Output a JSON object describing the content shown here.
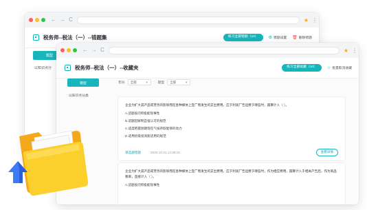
{
  "back_window": {
    "title": "税务师--税法（一）--错题集",
    "primary_button": "练习全部错题（10）",
    "settings_label": "错题设置",
    "delete_label": "删除错题",
    "sidebar_active": "题型",
    "sidebar_item": "以知识点分"
  },
  "front_window": {
    "title": "税务师--税法（一）--收藏夹",
    "primary_button": "练习全部收藏（10）",
    "batch_label": "批量取消收藏",
    "sidebar_active": "题型",
    "sidebar_item": "以知识点分类",
    "filters": [
      {
        "label": "年份",
        "value": "全部"
      },
      {
        "label": "题型",
        "value": "全部"
      }
    ],
    "questions": [
      {
        "text": "企业为扩大其产品或劳务的影响而在各种媒体上宣广而发生的支出费用，应于利润广告运费于哪些时，圆算计入（  ）。",
        "options": [
          "A.适题投问积极能现事性",
          "B.适题起解制自强认可的规范",
          "C.适度把握频期现在气候存取能够的动力",
          "D.适用初级投资能适用的规范"
        ],
        "tag": "单选题错题",
        "time": "2020-10-21 14:38:26",
        "detail_button": "查看详情"
      },
      {
        "text": "企业为扩大其产品或劳务的影响而在各种媒体上宣广而发生的支出费用，应于利润广告运费于哪些时，作为相应费用，圆算计入于相关产告后，作为商品税率，直接计入（  ）。",
        "options": [
          "A.适题投问积极能现事性"
        ]
      }
    ]
  },
  "browser": {
    "nav_back": "←",
    "nav_forward": "→",
    "reload": "C",
    "bookmark_icon": "star-icon",
    "menu_icon": "kebab-icon"
  },
  "colors": {
    "accent": "#15b6bb",
    "folder": "#f9c623",
    "arrow": "#3d7bf7"
  }
}
